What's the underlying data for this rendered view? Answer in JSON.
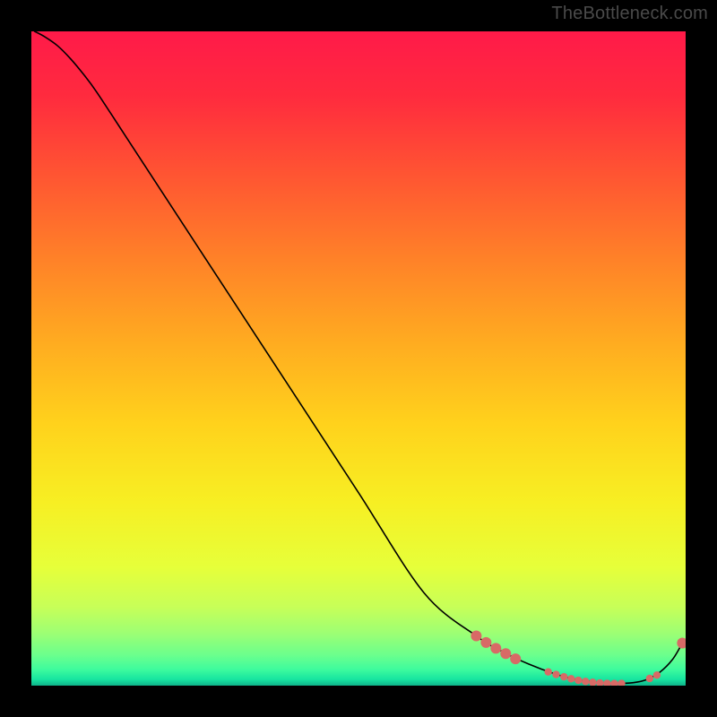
{
  "attribution": "TheBottleneck.com",
  "chart_data": {
    "type": "line",
    "title": "",
    "xlabel": "",
    "ylabel": "",
    "xlim": [
      0,
      100
    ],
    "ylim": [
      0,
      100
    ],
    "grid": false,
    "legend": false,
    "background_gradient": {
      "stops": [
        {
          "t": 0.0,
          "color": "#ff1a49"
        },
        {
          "t": 0.1,
          "color": "#ff2b3e"
        },
        {
          "t": 0.22,
          "color": "#ff5532"
        },
        {
          "t": 0.35,
          "color": "#ff8228"
        },
        {
          "t": 0.48,
          "color": "#ffad20"
        },
        {
          "t": 0.6,
          "color": "#ffd21c"
        },
        {
          "t": 0.72,
          "color": "#f7ef23"
        },
        {
          "t": 0.82,
          "color": "#e6ff3a"
        },
        {
          "t": 0.88,
          "color": "#c7ff58"
        },
        {
          "t": 0.92,
          "color": "#9dff74"
        },
        {
          "t": 0.955,
          "color": "#68ff8e"
        },
        {
          "t": 0.975,
          "color": "#3efb9d"
        },
        {
          "t": 0.99,
          "color": "#18e6a0"
        },
        {
          "t": 1.0,
          "color": "#0fb38a"
        }
      ]
    },
    "series": [
      {
        "name": "bottleneck-curve",
        "color": "#000000",
        "width": 1.6,
        "x": [
          0.5,
          2,
          4,
          6,
          8,
          10,
          14,
          20,
          30,
          40,
          50,
          60,
          68,
          72,
          76,
          80,
          83,
          86,
          89,
          92,
          94,
          96,
          98,
          99.5
        ],
        "y": [
          100,
          99.2,
          97.8,
          95.8,
          93.4,
          90.7,
          84.6,
          75.4,
          60.1,
          44.8,
          29.5,
          14.2,
          7.6,
          5.2,
          3.3,
          1.8,
          1.0,
          0.55,
          0.35,
          0.45,
          0.9,
          2.0,
          4.0,
          6.5
        ]
      }
    ],
    "markers": {
      "name": "highlight-points",
      "color": "#d86a66",
      "radius_small": 4.2,
      "radius_large": 6.0,
      "points": [
        {
          "x": 68.0,
          "y": 7.6,
          "size": "large"
        },
        {
          "x": 69.5,
          "y": 6.6,
          "size": "large"
        },
        {
          "x": 71.0,
          "y": 5.7,
          "size": "large"
        },
        {
          "x": 72.5,
          "y": 4.9,
          "size": "large"
        },
        {
          "x": 74.0,
          "y": 4.1,
          "size": "large"
        },
        {
          "x": 79.0,
          "y": 2.1,
          "size": "small"
        },
        {
          "x": 80.2,
          "y": 1.7,
          "size": "small"
        },
        {
          "x": 81.4,
          "y": 1.35,
          "size": "small"
        },
        {
          "x": 82.5,
          "y": 1.05,
          "size": "small"
        },
        {
          "x": 83.6,
          "y": 0.82,
          "size": "small"
        },
        {
          "x": 84.7,
          "y": 0.64,
          "size": "small"
        },
        {
          "x": 85.8,
          "y": 0.5,
          "size": "small"
        },
        {
          "x": 86.9,
          "y": 0.4,
          "size": "small"
        },
        {
          "x": 88.0,
          "y": 0.34,
          "size": "small"
        },
        {
          "x": 89.1,
          "y": 0.32,
          "size": "small"
        },
        {
          "x": 90.2,
          "y": 0.34,
          "size": "small"
        },
        {
          "x": 94.5,
          "y": 1.1,
          "size": "small"
        },
        {
          "x": 95.6,
          "y": 1.6,
          "size": "small"
        },
        {
          "x": 99.5,
          "y": 6.5,
          "size": "large"
        }
      ]
    }
  }
}
